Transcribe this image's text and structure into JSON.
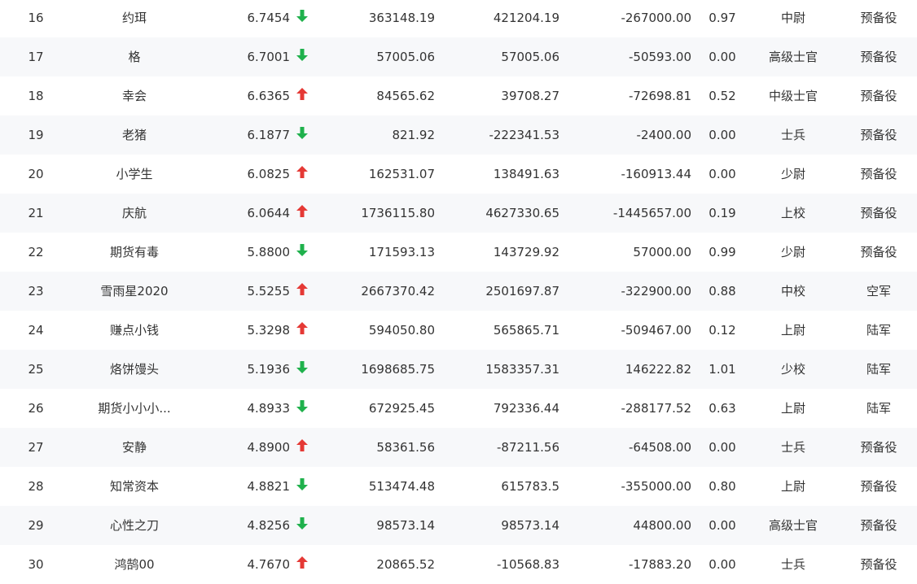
{
  "colors": {
    "up": "#e53935",
    "down": "#1fb14c",
    "row_alt": "#f7f8fa",
    "text": "#333333"
  },
  "rows": [
    {
      "rank": "16",
      "name": "约珥",
      "score": "6.7454",
      "trend": "down",
      "v1": "363148.19",
      "v2": "421204.19",
      "v3": "-267000.00",
      "ratio": "0.97",
      "title": "中尉",
      "status": "预备役"
    },
    {
      "rank": "17",
      "name": "格",
      "score": "6.7001",
      "trend": "down",
      "v1": "57005.06",
      "v2": "57005.06",
      "v3": "-50593.00",
      "ratio": "0.00",
      "title": "高级士官",
      "status": "预备役"
    },
    {
      "rank": "18",
      "name": "幸会",
      "score": "6.6365",
      "trend": "up",
      "v1": "84565.62",
      "v2": "39708.27",
      "v3": "-72698.81",
      "ratio": "0.52",
      "title": "中级士官",
      "status": "预备役"
    },
    {
      "rank": "19",
      "name": "老猪",
      "score": "6.1877",
      "trend": "down",
      "v1": "821.92",
      "v2": "-222341.53",
      "v3": "-2400.00",
      "ratio": "0.00",
      "title": "士兵",
      "status": "预备役"
    },
    {
      "rank": "20",
      "name": "小学生",
      "score": "6.0825",
      "trend": "up",
      "v1": "162531.07",
      "v2": "138491.63",
      "v3": "-160913.44",
      "ratio": "0.00",
      "title": "少尉",
      "status": "预备役"
    },
    {
      "rank": "21",
      "name": "庆航",
      "score": "6.0644",
      "trend": "up",
      "v1": "1736115.80",
      "v2": "4627330.65",
      "v3": "-1445657.00",
      "ratio": "0.19",
      "title": "上校",
      "status": "预备役"
    },
    {
      "rank": "22",
      "name": "期货有毒",
      "score": "5.8800",
      "trend": "down",
      "v1": "171593.13",
      "v2": "143729.92",
      "v3": "57000.00",
      "ratio": "0.99",
      "title": "少尉",
      "status": "预备役"
    },
    {
      "rank": "23",
      "name": "雪雨星2020",
      "score": "5.5255",
      "trend": "up",
      "v1": "2667370.42",
      "v2": "2501697.87",
      "v3": "-322900.00",
      "ratio": "0.88",
      "title": "中校",
      "status": "空军"
    },
    {
      "rank": "24",
      "name": "赚点小钱",
      "score": "5.3298",
      "trend": "up",
      "v1": "594050.80",
      "v2": "565865.71",
      "v3": "-509467.00",
      "ratio": "0.12",
      "title": "上尉",
      "status": "陆军"
    },
    {
      "rank": "25",
      "name": "烙饼馒头",
      "score": "5.1936",
      "trend": "down",
      "v1": "1698685.75",
      "v2": "1583357.31",
      "v3": "146222.82",
      "ratio": "1.01",
      "title": "少校",
      "status": "陆军"
    },
    {
      "rank": "26",
      "name": "期货小小小...",
      "score": "4.8933",
      "trend": "down",
      "v1": "672925.45",
      "v2": "792336.44",
      "v3": "-288177.52",
      "ratio": "0.63",
      "title": "上尉",
      "status": "陆军"
    },
    {
      "rank": "27",
      "name": "安静",
      "score": "4.8900",
      "trend": "up",
      "v1": "58361.56",
      "v2": "-87211.56",
      "v3": "-64508.00",
      "ratio": "0.00",
      "title": "士兵",
      "status": "预备役"
    },
    {
      "rank": "28",
      "name": "知常资本",
      "score": "4.8821",
      "trend": "down",
      "v1": "513474.48",
      "v2": "615783.5",
      "v3": "-355000.00",
      "ratio": "0.80",
      "title": "上尉",
      "status": "预备役"
    },
    {
      "rank": "29",
      "name": "心性之刀",
      "score": "4.8256",
      "trend": "down",
      "v1": "98573.14",
      "v2": "98573.14",
      "v3": "44800.00",
      "ratio": "0.00",
      "title": "高级士官",
      "status": "预备役"
    },
    {
      "rank": "30",
      "name": "鸿鹄00",
      "score": "4.7670",
      "trend": "up",
      "v1": "20865.52",
      "v2": "-10568.83",
      "v3": "-17883.20",
      "ratio": "0.00",
      "title": "士兵",
      "status": "预备役"
    }
  ]
}
